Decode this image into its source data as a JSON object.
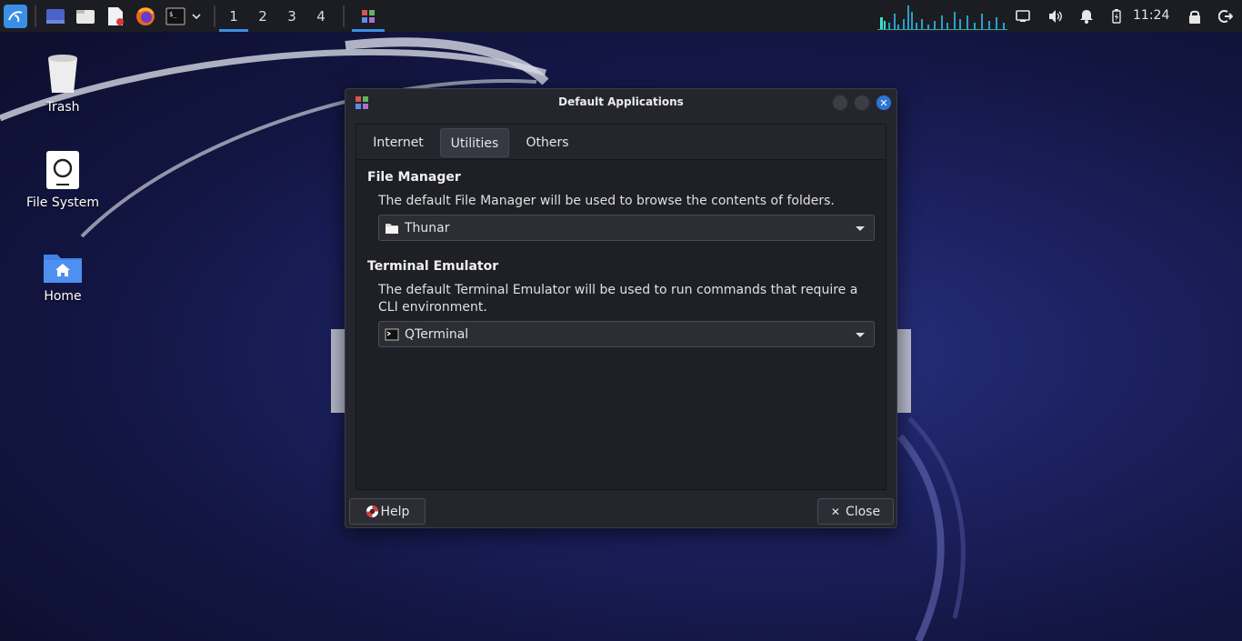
{
  "panel": {
    "workspaces": [
      "1",
      "2",
      "3",
      "4"
    ],
    "active_workspace": "1",
    "clock": "11:24",
    "icons": {
      "menu": "kali-menu-icon",
      "show_desktop": "show-desktop-icon",
      "file_manager": "file-manager-icon",
      "text_editor": "text-editor-icon",
      "browser": "firefox-icon",
      "terminal": "terminal-icon",
      "task_app": "default-applications-icon",
      "network": "network-icon",
      "volume": "volume-icon",
      "notifications": "bell-icon",
      "battery": "battery-icon",
      "lock": "lock-icon",
      "logout": "logout-icon"
    }
  },
  "desktop": {
    "icons": [
      {
        "label": "Trash",
        "icon": "trash-icon"
      },
      {
        "label": "File System",
        "icon": "drive-icon"
      },
      {
        "label": "Home",
        "icon": "home-folder-icon"
      }
    ]
  },
  "dialog": {
    "title": "Default Applications",
    "tabs": [
      {
        "label": "Internet",
        "selected": false
      },
      {
        "label": "Utilities",
        "selected": true
      },
      {
        "label": "Others",
        "selected": false
      }
    ],
    "file_manager": {
      "heading": "File Manager",
      "description": "The default File Manager will be used to browse the contents of folders.",
      "selected": "Thunar"
    },
    "terminal_emulator": {
      "heading": "Terminal Emulator",
      "description": "The default Terminal Emulator will be used to run commands that require a CLI environment.",
      "selected": "QTerminal"
    },
    "help_label": "Help",
    "close_label": "Close"
  },
  "colors": {
    "accent": "#3b8ee6",
    "panel_bg": "#1c1d22",
    "dialog_bg": "#25262d"
  }
}
